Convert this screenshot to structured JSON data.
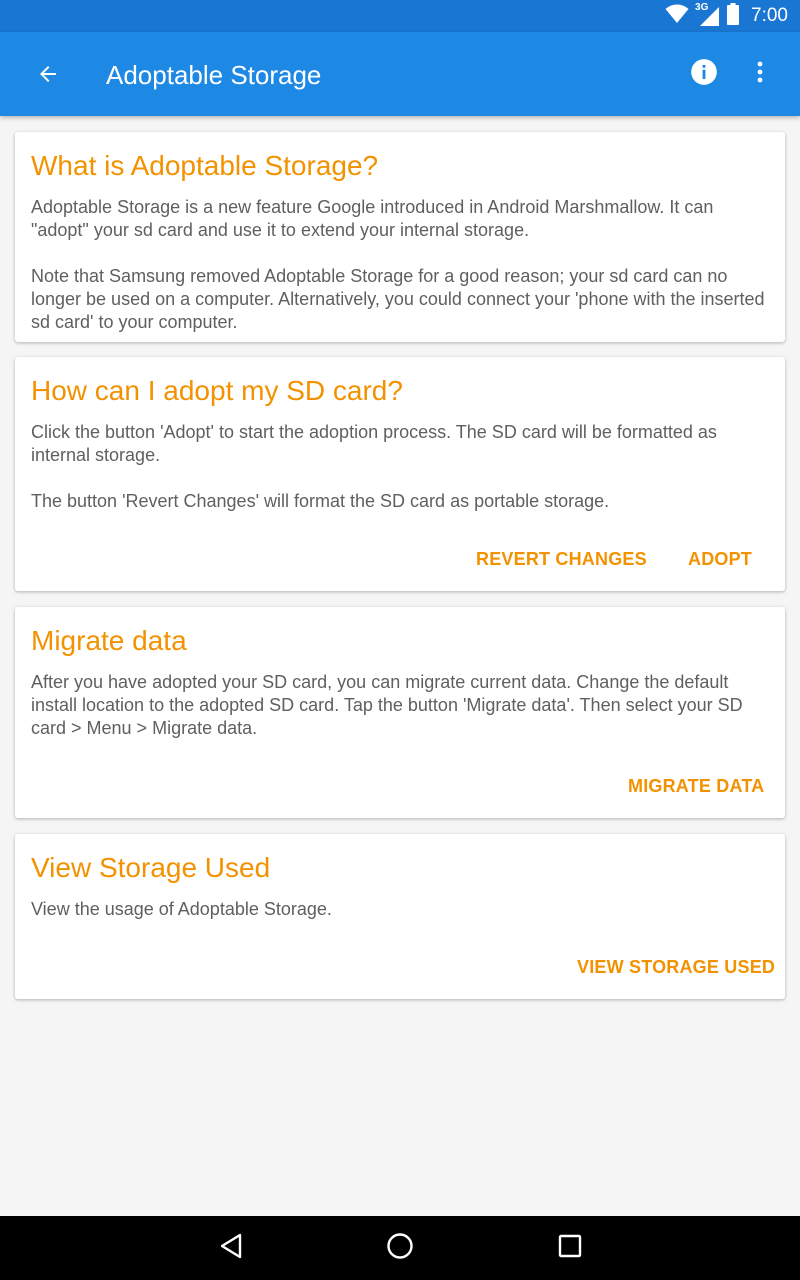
{
  "status_bar": {
    "time": "7:00",
    "network_type": "3G",
    "icons": [
      "wifi-icon",
      "cellular-signal-icon",
      "battery-icon"
    ]
  },
  "app_bar": {
    "title": "Adoptable Storage",
    "icons": [
      "back-arrow-icon",
      "info-icon",
      "more-vert-icon"
    ]
  },
  "cards": [
    {
      "title": "What is Adoptable Storage?",
      "paragraphs": [
        "Adoptable Storage is a new feature Google introduced in Android Marshmallow. It can \"adopt\" your sd card and use it to extend your internal storage.",
        "Note that Samsung removed Adoptable Storage for a good reason; your sd card can no longer be used on a computer. Alternatively, you could connect your 'phone with the inserted sd card' to your computer."
      ]
    },
    {
      "title": "How can I adopt my SD card?",
      "paragraphs": [
        "Click the button 'Adopt' to start the adoption process. The SD card will be formatted as internal storage.",
        "The button 'Revert Changes' will format the SD card as portable storage."
      ],
      "buttons": [
        "REVERT CHANGES",
        "ADOPT"
      ]
    },
    {
      "title": "Migrate data",
      "paragraphs": [
        "After you have adopted your SD card, you can migrate current data. Change the default install location to the adopted SD card. Tap the button 'Migrate data'. Then select your SD card > Menu > Migrate data."
      ],
      "buttons": [
        "MIGRATE DATA"
      ]
    },
    {
      "title": "View Storage Used",
      "paragraphs": [
        "View the usage of Adoptable Storage."
      ],
      "buttons": [
        "VIEW STORAGE USED"
      ]
    }
  ],
  "nav_bar": {
    "icons": [
      "back-triangle-icon",
      "home-circle-icon",
      "recents-square-icon"
    ]
  },
  "colors": {
    "status_bar": "#1976d2",
    "app_bar": "#1e88e5",
    "accent": "#f39200",
    "body_text": "#5f5f5f",
    "background": "#f5f5f5",
    "card": "#ffffff",
    "nav_bar": "#000000"
  }
}
